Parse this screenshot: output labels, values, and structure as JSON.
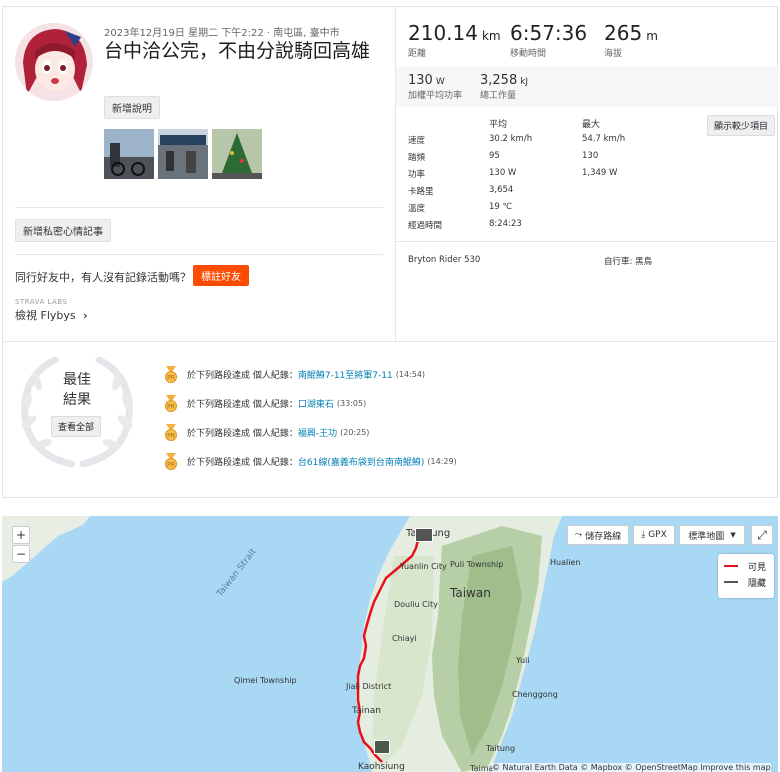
{
  "activity": {
    "date_location": "2023年12月19日 星期二 下午2:22 · 南屯區, 臺中市",
    "title": "台中洽公完，不由分說騎回高雄",
    "add_description": "新增說明",
    "add_private_note": "新增私密心情記事",
    "friends_prompt": "同行好友中，有人沒有記錄活動嗎？",
    "tag_friends": "標註好友",
    "labs": "STRAVA LABS",
    "flybys": "檢視 Flybys"
  },
  "stats": {
    "primary": [
      {
        "value": "210.14",
        "unit": "km",
        "label": "距離"
      },
      {
        "value": "6:57:36",
        "unit": "",
        "label": "移動時間"
      },
      {
        "value": "265",
        "unit": "m",
        "label": "海拔"
      }
    ],
    "secondary": [
      {
        "value": "130",
        "unit": "W",
        "label": "加權平均功率"
      },
      {
        "value": "3,258",
        "unit": "kJ",
        "label": "總工作量"
      }
    ],
    "show_less": "顯示較少項目",
    "table_headers": {
      "avg": "平均",
      "max": "最大"
    },
    "rows": [
      {
        "label": "速度",
        "avg": "30.2 km/h",
        "max": "54.7 km/h"
      },
      {
        "label": "踏頻",
        "avg": "95",
        "max": "130"
      },
      {
        "label": "功率",
        "avg": "130 W",
        "max": "1,349 W"
      },
      {
        "label": "卡路里",
        "avg": "3,654",
        "max": ""
      },
      {
        "label": "溫度",
        "avg": "19 ℃",
        "max": ""
      },
      {
        "label": "經過時間",
        "avg": "8:24:23",
        "max": ""
      }
    ],
    "device": "Bryton Rider 530",
    "bike": "自行車: 黑鳥"
  },
  "best_efforts": {
    "title_line1": "最佳",
    "title_line2": "結果",
    "view_all": "查看全部",
    "items": [
      {
        "prefix": "於下列路段達成 個人紀錄：",
        "segment": "南鯤鯓7-11至將軍7-11",
        "time": "(14:54)"
      },
      {
        "prefix": "於下列路段達成 個人紀錄：",
        "segment": "口湖東石",
        "time": "(33:05)"
      },
      {
        "prefix": "於下列路段達成 個人紀錄：",
        "segment": "福興-王功",
        "time": "(20:25)"
      },
      {
        "prefix": "於下列路段達成 個人紀錄：",
        "segment": "台61線(嘉義布袋到台南南鯤鯓)",
        "time": "(14:29)"
      }
    ]
  },
  "map": {
    "zoom_in": "+",
    "zoom_out": "−",
    "save_route": "儲存路線",
    "gpx": "GPX",
    "map_type": "標準地圖",
    "legend": [
      {
        "label": "可見",
        "color": "#e8101b"
      },
      {
        "label": "隱藏",
        "color": "#555555"
      }
    ],
    "labels": {
      "strait": "Taiwan Strait",
      "taiwan": "Taiwan",
      "taichung": "Taichung",
      "yuanlin": "Yuanlin City",
      "puli": "Puli Township",
      "hualien": "Hualien",
      "douliu": "Douliu City",
      "chiayi": "Chiayi",
      "yuli": "Yuli",
      "qimei": "Qimei Township",
      "jiali": "Jiali District",
      "tainan": "Tainan",
      "chenggong": "Chenggong",
      "taitung": "Taitung",
      "taimali": "Taimali",
      "kaohsiung": "Kaohsiung"
    },
    "attribution": "© Natural Earth Data © Mapbox © OpenStreetMap Improve this map"
  }
}
